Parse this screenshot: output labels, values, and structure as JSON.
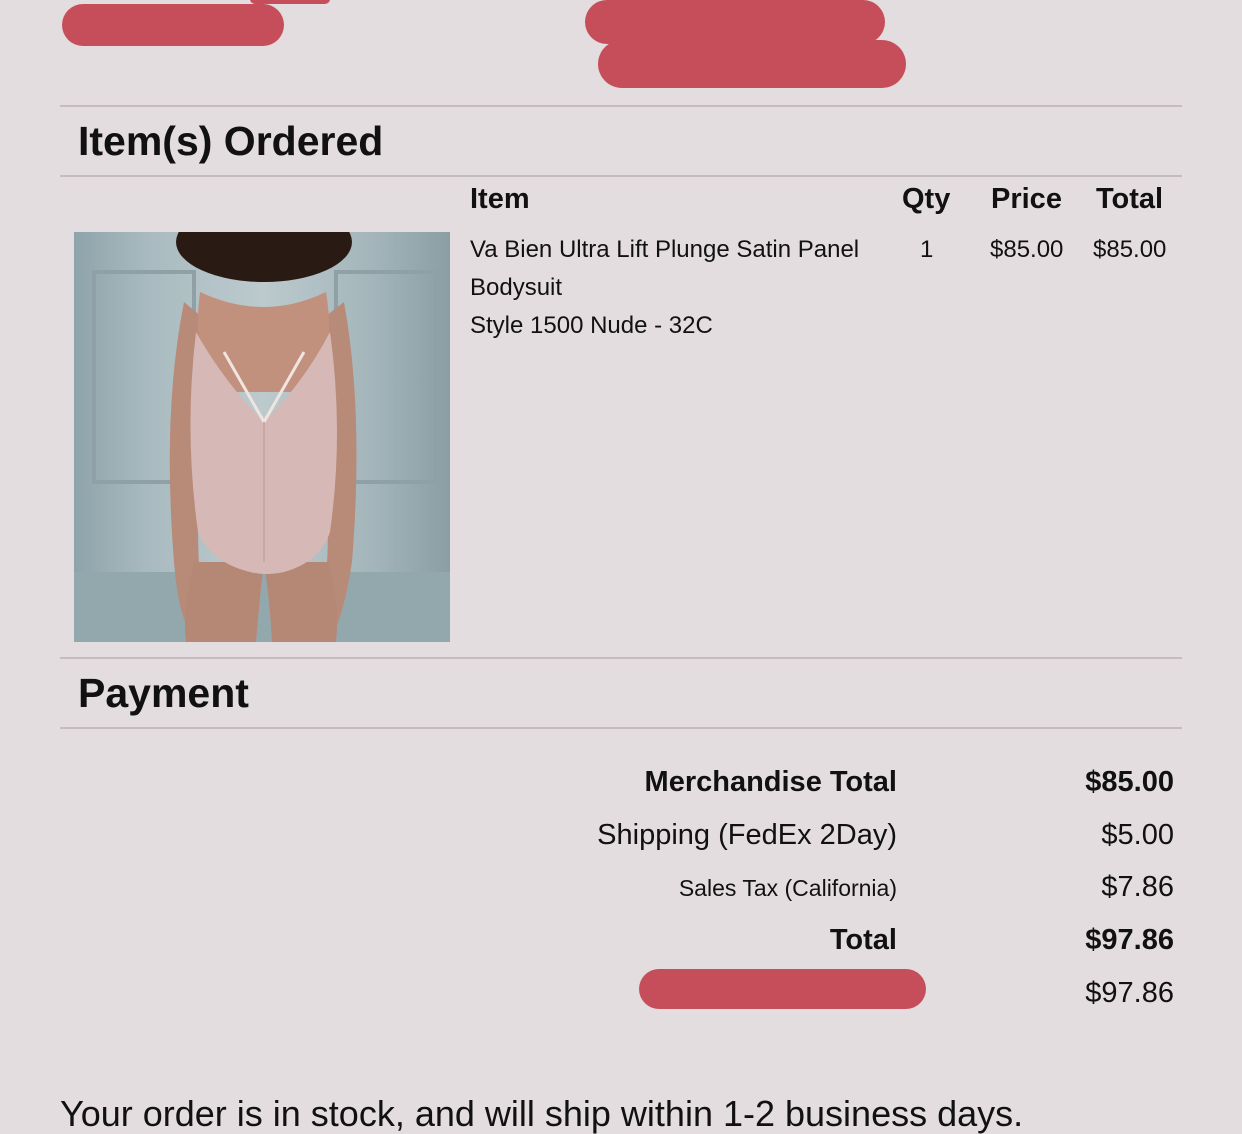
{
  "items_section": {
    "title": "Item(s) Ordered",
    "columns": {
      "item": "Item",
      "qty": "Qty",
      "price": "Price",
      "total": "Total"
    },
    "rows": [
      {
        "name_line1": "Va Bien Ultra Lift Plunge Satin Panel",
        "name_line2": "Bodysuit",
        "style": "Style 1500 Nude - 32C",
        "qty": "1",
        "price": "$85.00",
        "total": "$85.00"
      }
    ]
  },
  "payment_section": {
    "title": "Payment",
    "merchandise_total_label": "Merchandise Total",
    "merchandise_total_value": "$85.00",
    "shipping_label": "Shipping (FedEx 2Day)",
    "shipping_value": "$5.00",
    "tax_label": "Sales Tax (California)",
    "tax_value": "$7.86",
    "total_label": "Total",
    "total_value": "$97.86",
    "payment_amount_value": "$97.86"
  },
  "footer": {
    "note": "Your order is in stock, and will ship within 1-2 business days."
  },
  "colors": {
    "background": "#e4dde0",
    "redaction": "#c64e5a",
    "divider": "#c4bcc0"
  }
}
